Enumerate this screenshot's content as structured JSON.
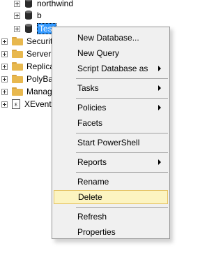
{
  "tree": {
    "databases": [
      {
        "label": "northwind",
        "icon": "database-icon"
      },
      {
        "label": "b",
        "icon": "database-icon"
      },
      {
        "label": "Test",
        "icon": "database-icon",
        "selected": true
      }
    ],
    "folders": [
      {
        "label": "Security",
        "icon": "folder-icon"
      },
      {
        "label": "Server Objects",
        "icon": "folder-icon"
      },
      {
        "label": "Replication",
        "icon": "folder-icon"
      },
      {
        "label": "PolyBase",
        "icon": "folder-icon"
      },
      {
        "label": "Management",
        "icon": "folder-icon"
      }
    ],
    "xevent": {
      "label": "XEvent Profiler",
      "icon": "xevent-icon",
      "glyph": "ε"
    }
  },
  "context_menu": {
    "items": [
      {
        "label": "New Database...",
        "submenu": false
      },
      {
        "label": "New Query",
        "submenu": false
      },
      {
        "label": "Script Database as",
        "submenu": true
      },
      {
        "label": "Tasks",
        "submenu": true
      },
      {
        "label": "Policies",
        "submenu": true
      },
      {
        "label": "Facets",
        "submenu": false
      },
      {
        "label": "Start PowerShell",
        "submenu": false
      },
      {
        "label": "Reports",
        "submenu": true
      },
      {
        "label": "Rename",
        "submenu": false
      },
      {
        "label": "Delete",
        "submenu": false,
        "highlighted": true
      },
      {
        "label": "Refresh",
        "submenu": false
      },
      {
        "label": "Properties",
        "submenu": false
      }
    ]
  },
  "colors": {
    "selection": "#3399ff",
    "menu_background": "#f0f0f0",
    "menu_highlight": "#fcf4c1",
    "menu_highlight_border": "#e5c365",
    "folder": "#e8b84e"
  }
}
